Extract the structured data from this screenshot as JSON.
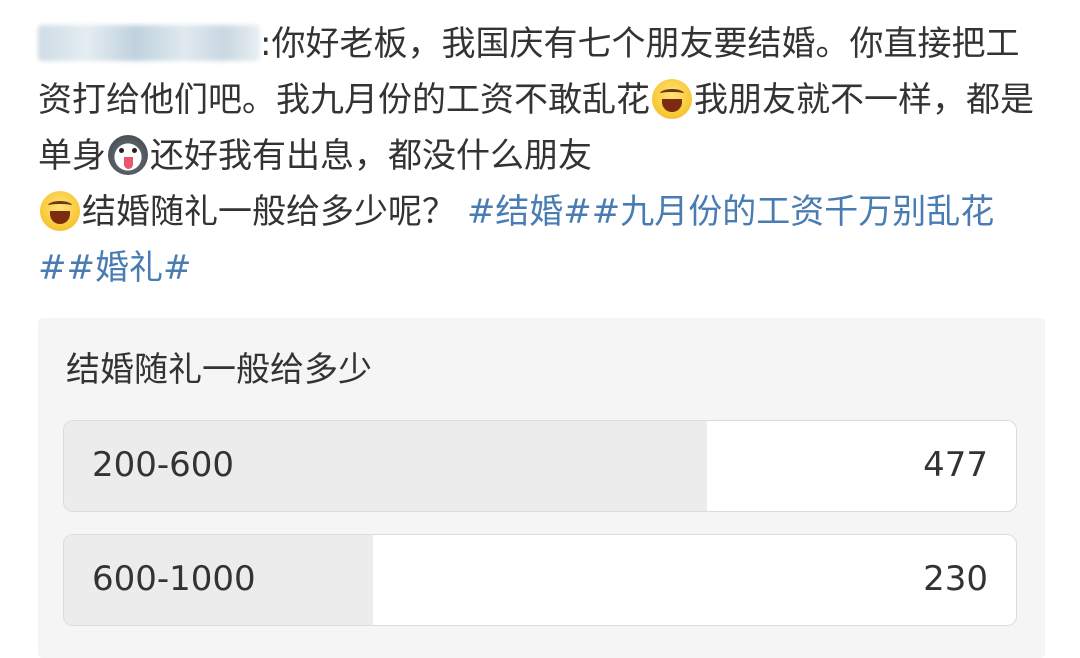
{
  "post": {
    "segment_1": ":你好老板，我国庆有七个朋友要结婚。你直接把工资打给他们吧。我九月份的工资不敢乱花",
    "emoji_1": "laughing-crying-emoji",
    "segment_2": "我朋友就不一样，都是单身",
    "emoji_2": "dog-tongue-emoji",
    "segment_3": "还好我有出息，都没什么朋友",
    "emoji_3": "laughing-emoji",
    "segment_4": "结婚随礼一般给多少呢？",
    "hashtags": [
      "#结婚#",
      "#九月份的工资千万别乱花#",
      "#婚礼#"
    ]
  },
  "poll": {
    "title": "结婚随礼一般给多少",
    "options": [
      {
        "label": "200-600",
        "count": "477",
        "share": 0.675
      },
      {
        "label": "600-1000",
        "count": "230",
        "share": 0.325
      }
    ]
  },
  "colors": {
    "text": "#333333",
    "hashtag": "#4a7cb4",
    "poll_bg": "#f5f5f5",
    "bar_fill": "#ececec"
  }
}
